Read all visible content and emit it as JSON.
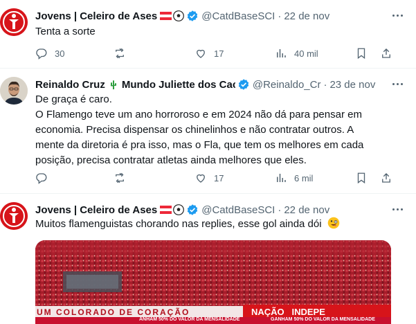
{
  "tweets": [
    {
      "name": "Jovens | Celeiro de Ases",
      "handle": "@CatdBaseSCI",
      "separator": "·",
      "date": "22 de nov",
      "text": "Tenta a sorte",
      "replies": "30",
      "retweets": "",
      "likes": "17",
      "views": "40 mil"
    },
    {
      "name": "Reinaldo Cruz",
      "name_suffix": "Mundo Juliette dos Cac",
      "handle": "@Reinaldo_Cr",
      "separator": "·",
      "date": "23 de nov",
      "text_lines": [
        "De graça é caro.",
        "O Flamengo teve um ano horroroso e em 2024 não dá para pensar em",
        "economia. Precisa dispensar os chinelinhos e não contratar outros. A",
        "mente da diretoria é pra isso, mas o Fla, que tem os melhores em cada",
        "posição, precisa contratar atletas ainda melhores que eles."
      ],
      "replies": "",
      "retweets": "",
      "likes": "17",
      "views": "6 mil"
    },
    {
      "name": "Jovens | Celeiro de Ases",
      "handle": "@CatdBaseSCI",
      "separator": "·",
      "date": "22 de nov",
      "text": "Muitos flamenguistas chorando nas replies, esse gol ainda dói",
      "media": {
        "banner_left": "UM COLORADO DE CORAÇÃO",
        "banner_right": "NAÇÃO   INDEPE",
        "bottom_left": "ANHAM 50% DO VALOR DA MENSALIDADE",
        "bottom_right": "GANHAM 50% DO VALOR DA MENSALIDADE"
      }
    }
  ],
  "colors": {
    "accent": "#1d9bf0",
    "muted": "#536471",
    "inter_red": "#d7141a",
    "cactus": "#2e9e3f"
  },
  "icons": [
    "reply-icon",
    "retweet-icon",
    "like-icon",
    "views-icon",
    "bookmark-icon",
    "share-icon",
    "verified-badge-icon",
    "more-icon"
  ]
}
